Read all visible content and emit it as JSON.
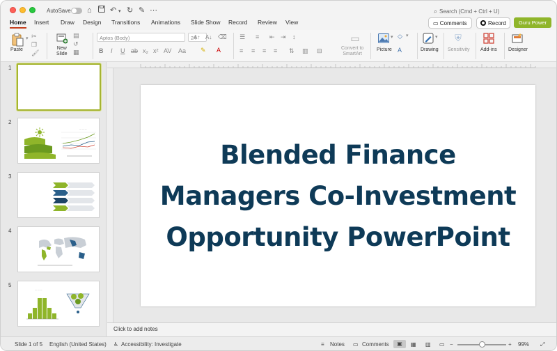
{
  "titlebar": {
    "autosave_label": "AutoSave",
    "search_placeholder": "Search (Cmd + Ctrl + U)"
  },
  "tabs": [
    "Home",
    "Insert",
    "Draw",
    "Design",
    "Transitions",
    "Animations",
    "Slide Show",
    "Record",
    "Review",
    "View"
  ],
  "actions": {
    "comments_label": "Comments",
    "record_label": "Record",
    "guru_label": "Guru Power",
    "guru_color": "#8fb52a"
  },
  "ribbon": {
    "paste_label": "Paste",
    "new_slide_label": "New\nSlide",
    "font_name_placeholder": "Aptos (Body)",
    "font_size": "24",
    "convert_smartart_label": "Convert to\nSmartArt",
    "picture_label": "Picture",
    "drawing_label": "Drawing",
    "sensitivity_label": "Sensitivity",
    "addins_label": "Add-ins",
    "designer_label": "Designer"
  },
  "slides": [
    {
      "number": "1",
      "selected": true
    },
    {
      "number": "2",
      "selected": false
    },
    {
      "number": "3",
      "selected": false
    },
    {
      "number": "4",
      "selected": false
    },
    {
      "number": "5",
      "selected": false
    }
  ],
  "slide": {
    "title_lines": [
      "Blended Finance",
      "Managers Co-Investment",
      "Opportunity PowerPoint"
    ],
    "title_color": "#0e3a57"
  },
  "notes_placeholder": "Click to add notes",
  "statusbar": {
    "slide_info": "Slide 1 of 5",
    "language": "English (United States)",
    "accessibility": "Accessibility: Investigate",
    "notes_label": "Notes",
    "comments_label": "Comments",
    "zoom": "99%"
  },
  "colors": {
    "accent_tab": "#c43e1c",
    "thumb_selected": "#a5b432"
  }
}
